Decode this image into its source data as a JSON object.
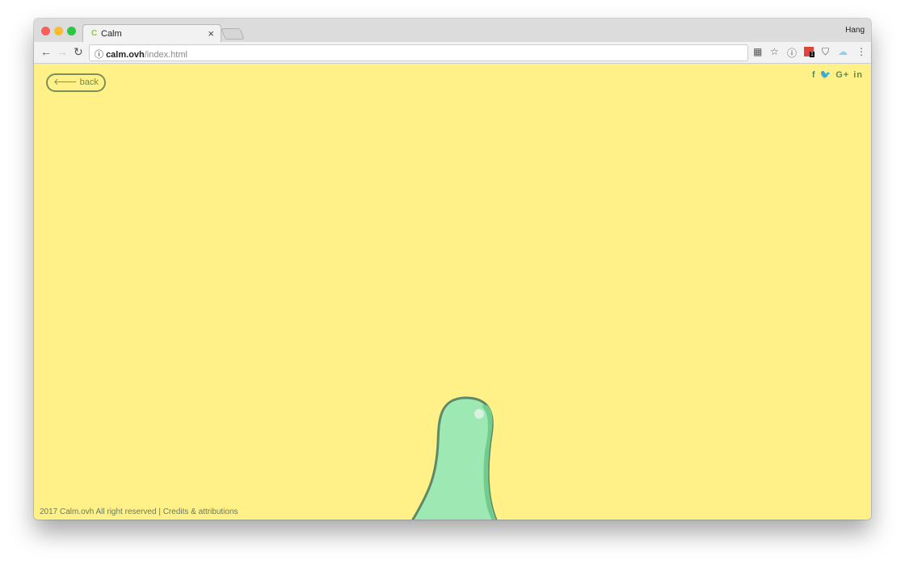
{
  "browser": {
    "tab_title": "Calm",
    "tab_favicon": "C",
    "tab_close": "×",
    "user": "Hang",
    "url_host": "calm.ovh",
    "url_path": "/index.html",
    "extension_badge": "1"
  },
  "page": {
    "back_label": "back",
    "social": [
      "f",
      "t",
      "G+",
      "in"
    ],
    "footer_left": "2017 Calm.ovh All right reserved",
    "footer_sep": "|",
    "footer_link": "Credits & attributions",
    "background": "#fff187",
    "accent": "#5c8a56"
  }
}
